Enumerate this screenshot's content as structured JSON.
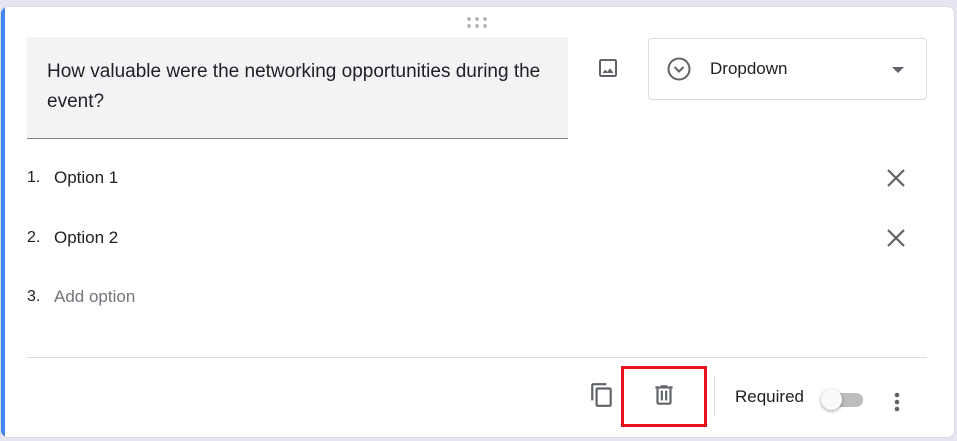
{
  "question": {
    "text": "How valuable were the networking opportunities during the event?"
  },
  "question_type": {
    "label": "Dropdown",
    "icon": "circle-chevron-down-icon"
  },
  "options": [
    {
      "number": "1.",
      "label": "Option 1"
    },
    {
      "number": "2.",
      "label": "Option 2"
    }
  ],
  "add_option": {
    "number": "3.",
    "label": "Add option"
  },
  "footer": {
    "required_label": "Required",
    "required_on": false
  },
  "colors": {
    "accent": "#4285f4",
    "highlight": "#e8121e",
    "toggle_off": "#bdbdbd"
  }
}
